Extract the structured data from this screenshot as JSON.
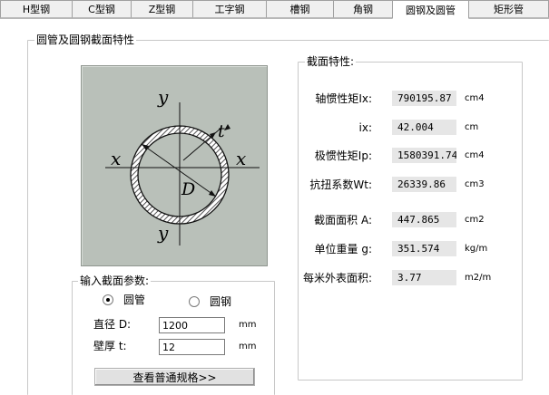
{
  "tabs": [
    {
      "label": "H型钢",
      "active": false
    },
    {
      "label": "C型钢",
      "active": false
    },
    {
      "label": "Z型钢",
      "active": false
    },
    {
      "label": "工字钢",
      "active": false
    },
    {
      "label": "槽钢",
      "active": false
    },
    {
      "label": "角钢",
      "active": false
    },
    {
      "label": "圆钢及圆管",
      "active": true
    },
    {
      "label": "矩形管",
      "active": false
    }
  ],
  "main_group": {
    "title": "圆管及圆钢截面特性"
  },
  "drawing": {
    "axis_y_top": "y",
    "axis_y_bottom": "y",
    "axis_x_left": "x",
    "axis_x_right": "x",
    "thickness_label": "t",
    "diameter_label": "D",
    "background": "#b9c0b9"
  },
  "properties": {
    "title": "截面特性:",
    "rows": [
      {
        "label": "轴惯性矩Ix:",
        "value": "790195.87",
        "unit": "cm4"
      },
      {
        "label": "ix:",
        "value": "42.004",
        "unit": "cm"
      },
      {
        "label": "极惯性矩Ip:",
        "value": "1580391.74",
        "unit": "cm4"
      },
      {
        "label": "抗扭系数Wt:",
        "value": "26339.86",
        "unit": "cm3"
      },
      {
        "label": "截面面积 A:",
        "value": "447.865",
        "unit": "cm2"
      },
      {
        "label": "单位重量 g:",
        "value": "351.574",
        "unit": "kg/m"
      },
      {
        "label": "每米外表面积:",
        "value": "3.77",
        "unit": "m2/m"
      }
    ]
  },
  "input_group": {
    "title": "输入截面参数:",
    "radio_pipe": {
      "label": "圆管",
      "checked": true
    },
    "radio_bar": {
      "label": "圆钢",
      "checked": false
    },
    "diameter": {
      "label": "直径 D:",
      "value": "1200",
      "unit": "mm"
    },
    "thickness": {
      "label": "壁厚 t:",
      "value": "12",
      "unit": "mm"
    },
    "button_label": "查看普通规格>>"
  }
}
